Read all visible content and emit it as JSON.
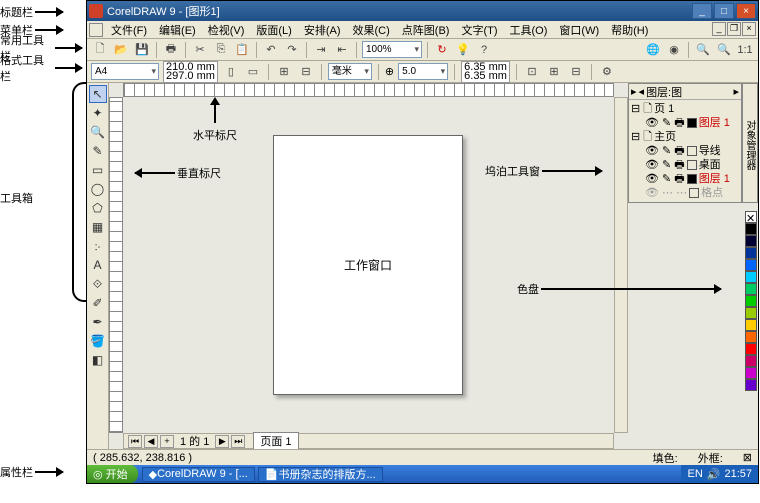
{
  "annotations": {
    "title": "标题栏",
    "menu": "菜单栏",
    "std": "常用工具栏",
    "fmt": "格式工具栏",
    "toolbox": "工具箱",
    "prop": "属性栏",
    "hRuler": "水平标尺",
    "vRuler": "垂直标尺",
    "work": "工作窗口",
    "docker": "坞泊工具窗",
    "palette": "色盘"
  },
  "title": {
    "app": "CorelDRAW 9 - [图形1]"
  },
  "menu": {
    "items": [
      "文件(F)",
      "编辑(E)",
      "检视(V)",
      "版面(L)",
      "安排(A)",
      "效果(C)",
      "点阵图(B)",
      "文字(T)",
      "工具(O)",
      "窗口(W)",
      "帮助(H)"
    ]
  },
  "zoom": "100%",
  "prop": {
    "paper": "A4",
    "w": "210.0 mm",
    "h": "297.0 mm",
    "units": "毫米",
    "nudge": "5.0 mm",
    "dupx": "6.35 mm",
    "dupy": "6.35 mm"
  },
  "page": {
    "nav": "1 的 1",
    "tab": "页面 1"
  },
  "status": {
    "coords": "( 285.632, 238.816 )",
    "fill": "填色:",
    "outline": "外框:"
  },
  "docker": {
    "title": "图层:图",
    "page1": "页 1",
    "layer1": "图层 1",
    "master": "主页",
    "guides": "导线",
    "desktop": "桌面",
    "grid": "格点"
  },
  "vtab": "对象管理器",
  "palette": [
    "#fff",
    "#000",
    "#003",
    "#009",
    "#00f",
    "#0ff",
    "#0f0",
    "#ff0",
    "#f90",
    "#f00",
    "#f0f",
    "#909",
    "#960",
    "#999",
    "#ccc"
  ],
  "taskbar": {
    "start": "开始",
    "t1": "CorelDRAW 9 - [...",
    "t2": "书册杂志的排版方...",
    "lang": "EN",
    "time": "21:57"
  }
}
